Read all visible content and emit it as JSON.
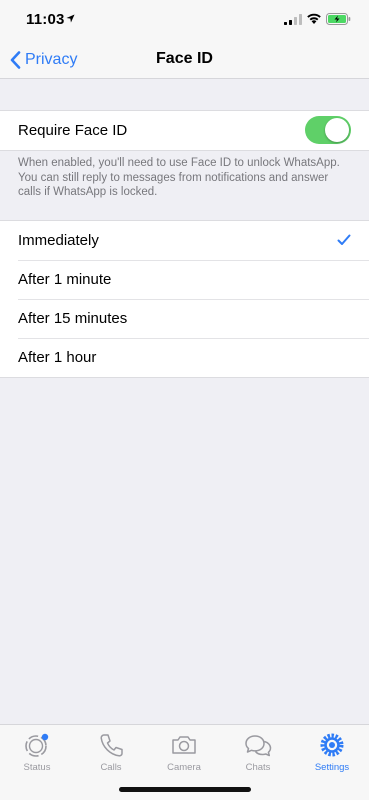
{
  "status_bar": {
    "time": "11:03"
  },
  "nav": {
    "back_label": "Privacy",
    "title": "Face ID"
  },
  "require_face_id": {
    "label": "Require Face ID",
    "enabled": true
  },
  "footnote": "When enabled, you'll need to use Face ID to unlock WhatsApp. You can still reply to messages from notifications and answer calls if WhatsApp is locked.",
  "lock_options": [
    {
      "label": "Immediately",
      "selected": true
    },
    {
      "label": "After 1 minute",
      "selected": false
    },
    {
      "label": "After 15 minutes",
      "selected": false
    },
    {
      "label": "After 1 hour",
      "selected": false
    }
  ],
  "tabs": [
    {
      "label": "Status",
      "icon": "status-icon",
      "active": false
    },
    {
      "label": "Calls",
      "icon": "phone-icon",
      "active": false
    },
    {
      "label": "Camera",
      "icon": "camera-icon",
      "active": false
    },
    {
      "label": "Chats",
      "icon": "chat-bubbles-icon",
      "active": false
    },
    {
      "label": "Settings",
      "icon": "gear-icon",
      "active": true
    }
  ],
  "colors": {
    "accent": "#2f7cf6",
    "toggle_on": "#5fd068",
    "background": "#efeff4"
  }
}
